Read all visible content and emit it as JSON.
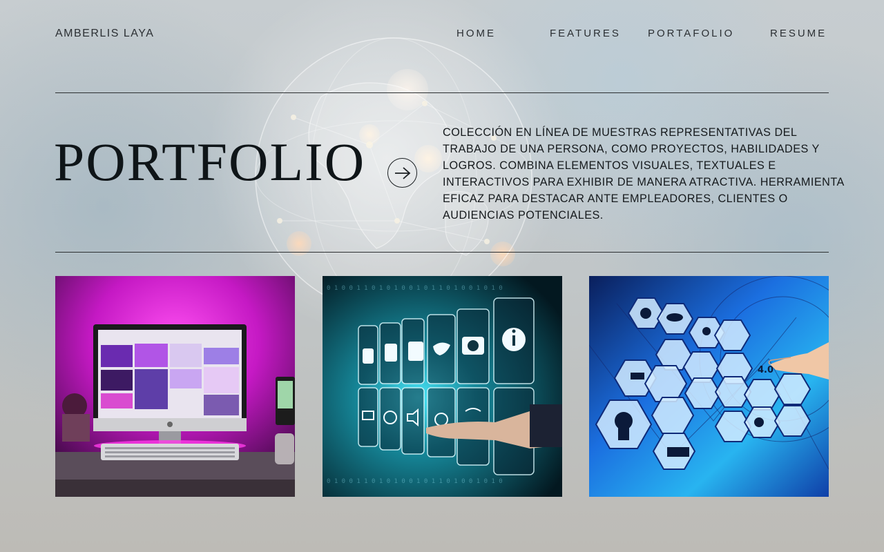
{
  "header": {
    "brand": "AMBERLIS LAYA",
    "nav": [
      {
        "label": "HOME"
      },
      {
        "label": "FEATURES"
      },
      {
        "label": "PORTAFOLIO"
      },
      {
        "label": "RESUME"
      }
    ]
  },
  "hero": {
    "title": "PORTFOLIO",
    "arrow_icon": "arrow-right-circle-icon",
    "description": " COLECCIÓN EN LÍNEA DE MUESTRAS REPRESENTATIVAS DEL TRABAJO DE UNA PERSONA, COMO PROYECTOS, HABILIDADES Y LOGROS. COMBINA ELEMENTOS VISUALES, TEXTUALES E INTERACTIVOS PARA EXHIBIR DE MANERA ATRACTIVA. HERRAMIENTA EFICAZ PARA DESTACAR ANTE EMPLEADORES, CLIENTES O AUDIENCIAS POTENCIALES."
  },
  "gallery": {
    "items": [
      {
        "image": "desktop-computer-pink-light-photo"
      },
      {
        "image": "social-media-icons-touchscreen-photo"
      },
      {
        "image": "industry-4-0-hexagon-icons-photo"
      }
    ],
    "card2_binary": "0 1 0 0 1 1 0 1 0 1 0 0 1 0 1 1 0 1 0 0 1 0 1 0",
    "card3_label": "4.0"
  },
  "colors": {
    "text": "#1f2326",
    "rule": "#2c2f31",
    "card1_magenta": "#e01adf",
    "card2_teal": "#2fc4d8",
    "card3_blue": "#1b5fd6"
  }
}
